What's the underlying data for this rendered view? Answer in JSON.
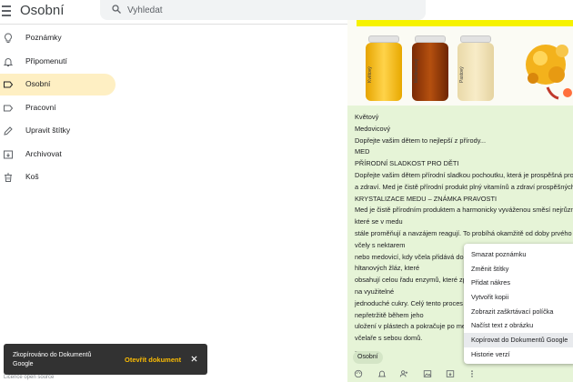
{
  "app": {
    "title": "Osobní"
  },
  "search": {
    "placeholder": "Vyhledat"
  },
  "sidebar": {
    "items": [
      {
        "label": "Poznámky",
        "icon": "lightbulb-icon",
        "active": false
      },
      {
        "label": "Připomenutí",
        "icon": "bell-icon",
        "active": false
      },
      {
        "label": "Osobní",
        "icon": "label-icon",
        "active": true
      },
      {
        "label": "Pracovní",
        "icon": "label-icon",
        "active": false
      },
      {
        "label": "Upravit štítky",
        "icon": "pencil-icon",
        "active": false
      },
      {
        "label": "Archivovat",
        "icon": "archive-icon",
        "active": false
      },
      {
        "label": "Koš",
        "icon": "trash-icon",
        "active": false
      }
    ]
  },
  "note": {
    "image_jar_labels": [
      "Květový",
      "Medovicový",
      "Pastový"
    ],
    "lines": [
      "Květový",
      "Medovicový",
      "Dopřejte vašim dětem to nejlepší z přírody...",
      "MED",
      "PŘÍRODNÍ SLADKOST PRO DĚTI",
      "Dopřejte vašim dětem přírodní sladkou pochoutku, která je prospěšná pro",
      "a zdraví. Med je čistě přírodní produkt plný vitamínů a zdraví prospěšných",
      "KRYSTALIZACE MEDU – ZNÁMKA PRAVOSTI",
      "Med je čistě přírodním produktem a harmonicky vyváženou směsí nejrůzn",
      "které se v medu",
      "stále proměňují a navzájem reagují. To probíhá okamžitě od doby prvého l",
      "včely s nektarem",
      "nebo medovicí, kdy včela přidává do sebraného materiálu sekrety svých",
      "hltanových žláz, které",
      "obsahují celou řadu enzymů, které zp",
      "na využitelné",
      "jednoduché cukry. Celý tento proces",
      "nepřetržitě během jeho",
      "uložení v plástech a pokračuje po me",
      "včelaře s sebou domů.",
      "..."
    ],
    "label_chip": "Osobní",
    "toolbar_icons": [
      "palette-icon",
      "bell-icon",
      "add-person-icon",
      "image-icon",
      "archive-icon",
      "more-icon"
    ]
  },
  "menu": {
    "items": [
      "Smazat poznámku",
      "Změnit štítky",
      "Přidat nákres",
      "Vytvořit kopii",
      "Zobrazit zaškrtávací políčka",
      "Načíst text z obrázku",
      "Kopírovat do Dokumentů Google",
      "Historie verzí"
    ],
    "highlighted_index": 6
  },
  "snackbar": {
    "message": "Zkopírováno do Dokumentů Google",
    "action": "Otevřít dokument"
  },
  "footer": {
    "text": "Licence open source"
  },
  "colors": {
    "active_nav": "#feefc3",
    "note_bg": "#e6f4d7",
    "snackbar_bg": "#323232",
    "snackbar_action": "#fbbc04"
  }
}
